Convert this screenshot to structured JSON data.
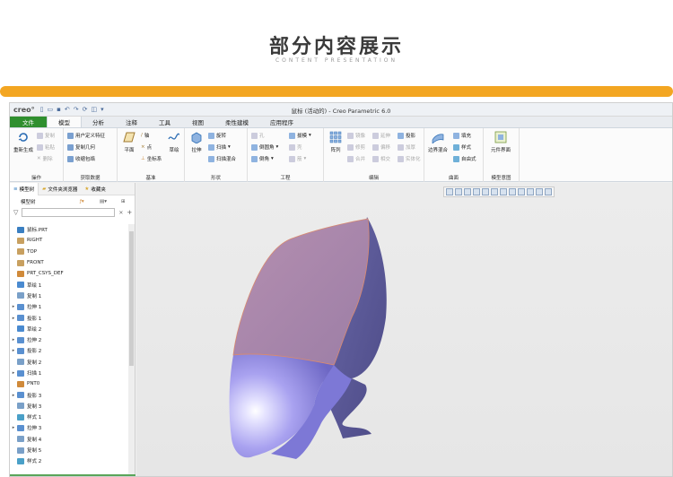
{
  "header": {
    "title": "部分内容展示",
    "subtitle": "CONTENT PRESENTATION"
  },
  "app": {
    "logo": "creo°",
    "window_title": "鼠标 (活动的) - Creo Parametric 6.0",
    "tabs": [
      "文件",
      "模型",
      "分析",
      "注释",
      "工具",
      "视图",
      "柔性建模",
      "应用程序"
    ],
    "ribbon": {
      "ops": {
        "regen": "重新生成",
        "copy": "复制",
        "paste": "粘贴",
        "delete": "删除",
        "label": "操作"
      },
      "getdata": {
        "udf": "用户定义特征",
        "copy_geom": "复制几何",
        "shrinkwrap": "收缩包络",
        "label": "获取数据"
      },
      "datum": {
        "plane": "平面",
        "axis": "轴",
        "point": "点",
        "csys": "坐标系",
        "sketch": "草绘",
        "label": "基准"
      },
      "shapes": {
        "extrude": "拉伸",
        "revolve": "旋转",
        "sweep": "扫描",
        "swept_blend": "扫描混合",
        "label": "形状"
      },
      "eng": {
        "hole": "孔",
        "round": "倒圆角",
        "chamfer": "倒角",
        "draft": "拔模",
        "shell": "壳",
        "rib": "筋",
        "label": "工程"
      },
      "edit": {
        "pattern": "阵列",
        "mirror": "镜像",
        "extend": "延伸",
        "project": "投影",
        "trim": "修剪",
        "offset": "偏移",
        "thicken": "加厚",
        "merge": "合并",
        "intersect": "相交",
        "solidify": "实体化",
        "label": "编辑"
      },
      "surface": {
        "boundary": "边界混合",
        "fill": "填充",
        "style": "样式",
        "freeform": "自由式",
        "label": "曲面"
      },
      "intent": {
        "component": "元件界面",
        "label": "模型意图"
      }
    },
    "panel": {
      "tabs": [
        "模型树",
        "文件夹浏览器",
        "收藏夹"
      ],
      "tree_header": "模型树",
      "items": [
        {
          "label": "鼠标.PRT",
          "exp": "",
          "color": "#3a7fc1"
        },
        {
          "label": "RIGHT",
          "exp": "",
          "color": "#c8a060"
        },
        {
          "label": "TOP",
          "exp": "",
          "color": "#c8a060"
        },
        {
          "label": "FRONT",
          "exp": "",
          "color": "#c8a060"
        },
        {
          "label": "PRT_CSYS_DEF",
          "exp": "",
          "color": "#d08a3a"
        },
        {
          "label": "草绘 1",
          "exp": "",
          "color": "#4a8ad0"
        },
        {
          "label": "复制 1",
          "exp": "",
          "color": "#7aa0c8"
        },
        {
          "label": "拉伸 1",
          "exp": "▸",
          "color": "#5a90d0"
        },
        {
          "label": "投影 1",
          "exp": "▸",
          "color": "#5a90d0"
        },
        {
          "label": "草绘 2",
          "exp": "",
          "color": "#4a8ad0"
        },
        {
          "label": "拉伸 2",
          "exp": "▸",
          "color": "#5a90d0"
        },
        {
          "label": "投影 2",
          "exp": "▸",
          "color": "#5a90d0"
        },
        {
          "label": "复制 2",
          "exp": "",
          "color": "#7aa0c8"
        },
        {
          "label": "扫描 1",
          "exp": "▸",
          "color": "#5a90d0"
        },
        {
          "label": "PNT0",
          "exp": "",
          "color": "#d08a3a"
        },
        {
          "label": "投影 3",
          "exp": "▸",
          "color": "#5a90d0"
        },
        {
          "label": "复制 3",
          "exp": "",
          "color": "#7aa0c8"
        },
        {
          "label": "样式 1",
          "exp": "",
          "color": "#4aa0c8"
        },
        {
          "label": "拉伸 3",
          "exp": "▸",
          "color": "#5a90d0"
        },
        {
          "label": "复制 4",
          "exp": "",
          "color": "#7aa0c8"
        },
        {
          "label": "复制 5",
          "exp": "",
          "color": "#7aa0c8"
        },
        {
          "label": "样式 2",
          "exp": "",
          "color": "#4aa0c8"
        }
      ]
    }
  }
}
